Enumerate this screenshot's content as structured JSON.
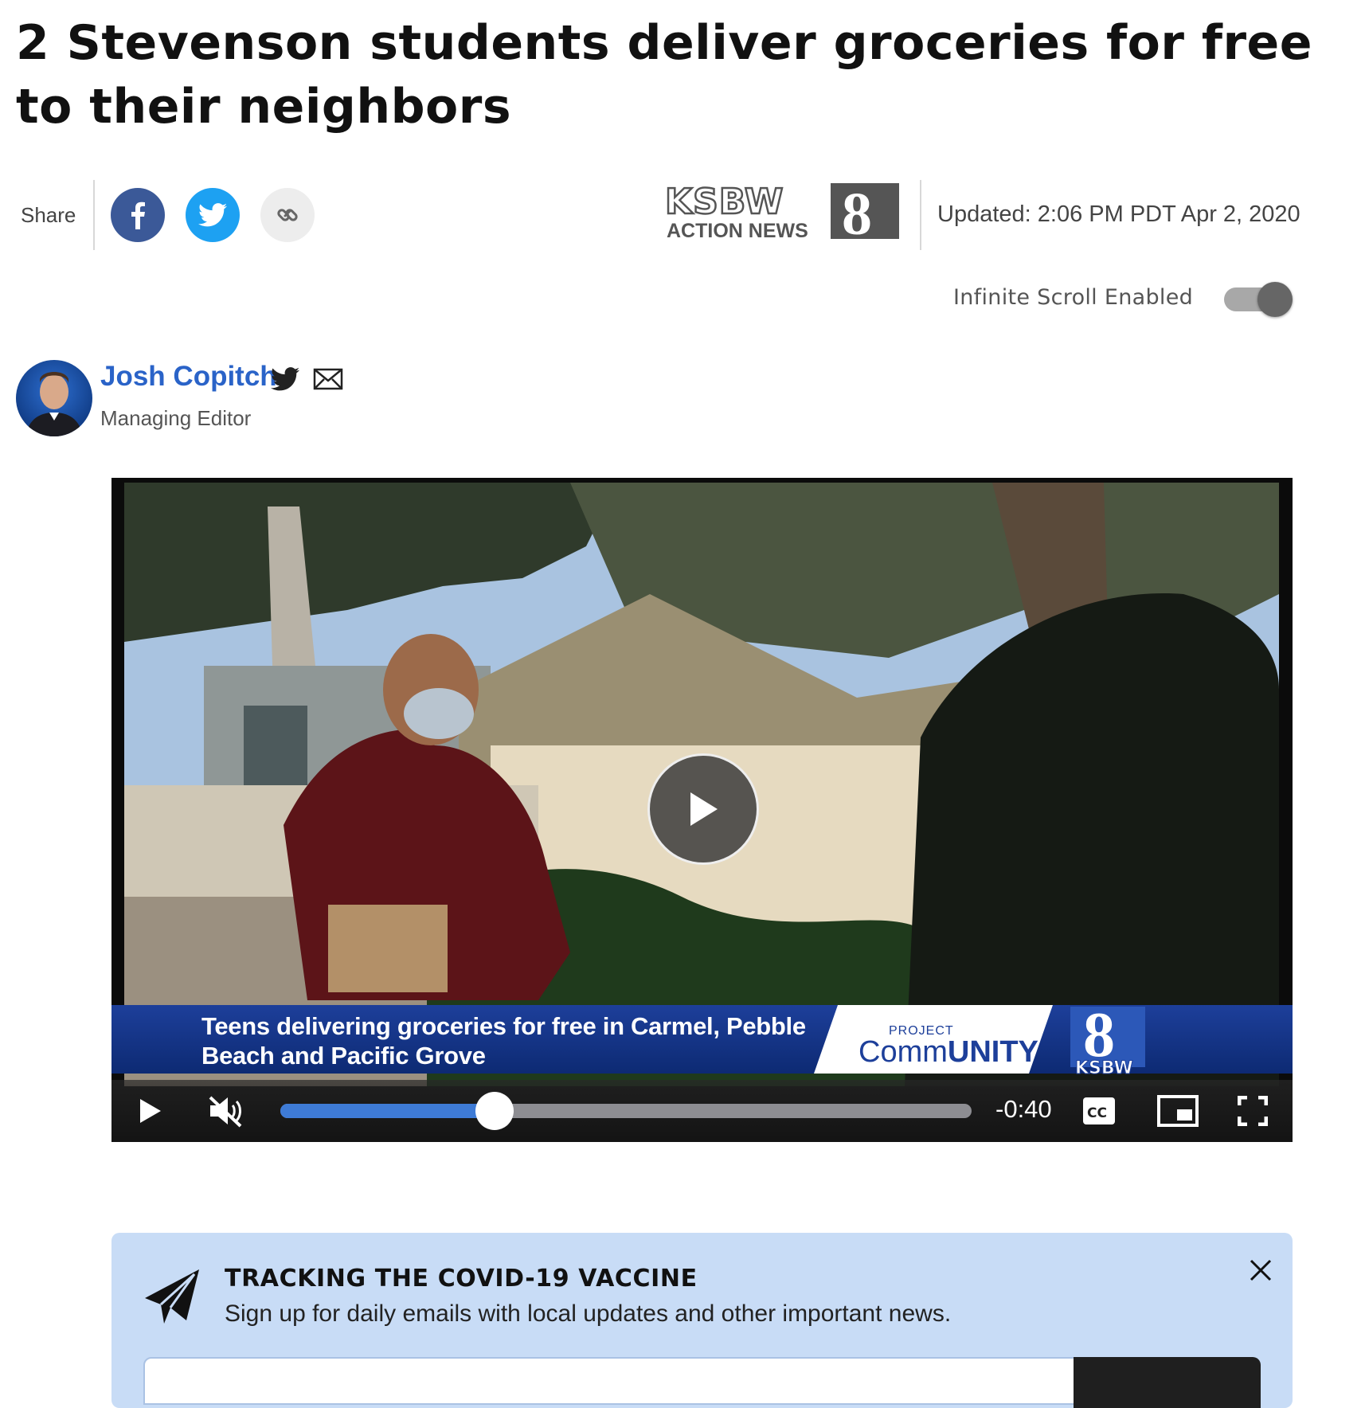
{
  "article": {
    "headline": "2 Stevenson students deliver groceries for free to their neighbors",
    "updated": "Updated: 2:06 PM PDT Apr 2, 2020"
  },
  "share": {
    "label": "Share",
    "buttons": [
      {
        "name": "facebook",
        "icon": "facebook-icon",
        "color": "#3b5998"
      },
      {
        "name": "twitter",
        "icon": "twitter-icon",
        "color": "#1da1f2"
      },
      {
        "name": "copy-link",
        "icon": "link-icon",
        "color": "#ededed"
      }
    ]
  },
  "brand": {
    "logo_top": "KSBW",
    "logo_number": "8",
    "logo_bottom": "ACTION NEWS"
  },
  "infinite_scroll": {
    "label": "Infinite Scroll Enabled",
    "enabled": true
  },
  "author": {
    "name": "Josh Copitch",
    "title": "Managing Editor"
  },
  "video": {
    "lower_third": "Teens delivering groceries for free in Carmel, Pebble Beach and Pacific Grove",
    "program_small": "PROJECT",
    "program_comm": "Comm",
    "program_unity": "UNITY",
    "station_number": "8",
    "station_call": "KSBW",
    "time_remaining": "-0:40",
    "progress": 0.31,
    "muted": true,
    "controls": [
      "play-icon",
      "mute-icon",
      "cc-icon",
      "picture-in-picture-icon",
      "fullscreen-icon"
    ],
    "cc_label": "CC"
  },
  "promo": {
    "title": "TRACKING THE COVID-19 VACCINE",
    "subtitle": "Sign up for daily emails with local updates and other important news."
  },
  "colors": {
    "author_link": "#2a63c8",
    "promo_bg": "#c8dcf6",
    "progress_fill": "#3e7bd6",
    "lower_third_bg": "#1d3f9a"
  }
}
